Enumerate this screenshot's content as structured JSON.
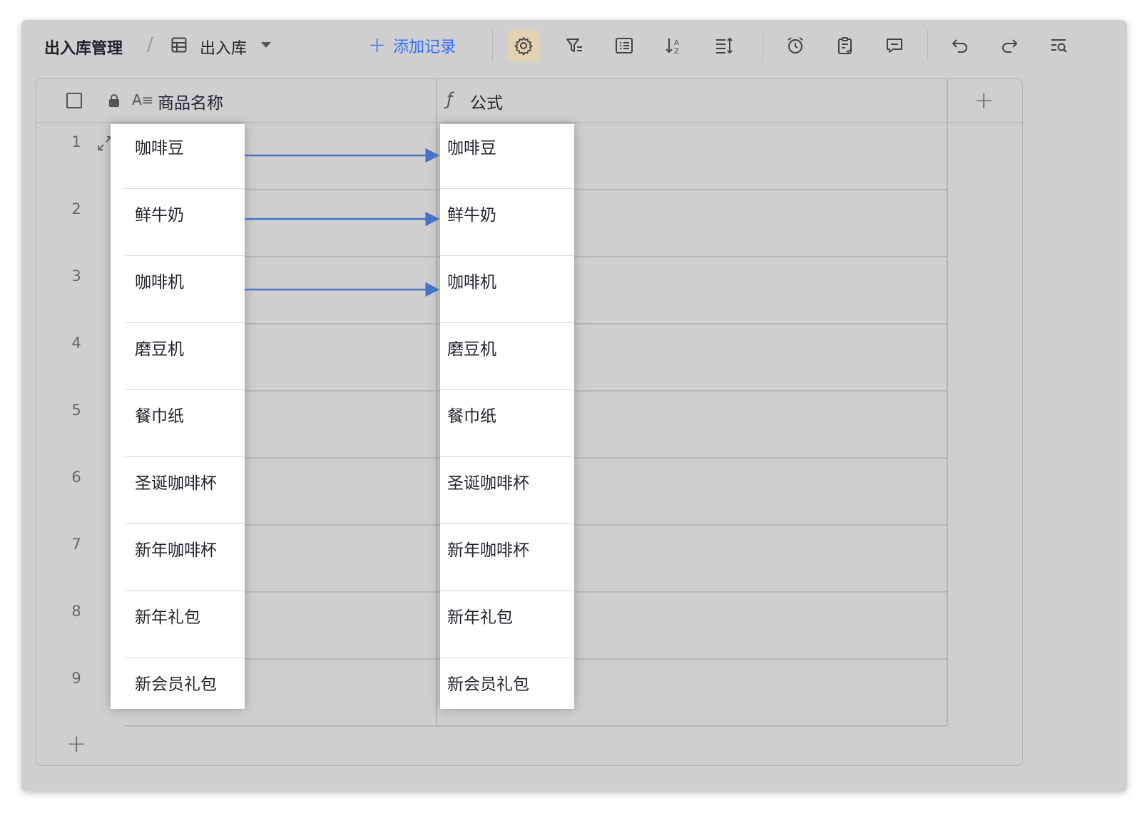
{
  "toolbar": {
    "base_name": "出入库管理",
    "separator": "/",
    "view_name": "出入库",
    "add_record_label": "添加记录",
    "plus_glyph": "+",
    "active_tool": "settings-icon",
    "tools": [
      "settings-icon",
      "filter-icon",
      "group-icon",
      "sort-icon",
      "row-height-icon",
      "reminder-icon",
      "form-icon",
      "comment-icon",
      "undo-icon",
      "redo-icon",
      "search-icon"
    ]
  },
  "table": {
    "columns": [
      {
        "name": "商品名称",
        "type": "text",
        "icon": "text-field-icon",
        "locked": true
      },
      {
        "name": "公式",
        "type": "formula",
        "icon": "formula-icon"
      }
    ],
    "text_icon_glyph": "A≡",
    "formula_icon_glyph": "ƒ",
    "add_column_glyph": "+",
    "add_row_glyph": "+",
    "rows": [
      {
        "num": "1",
        "name": "咖啡豆",
        "formula": "咖啡豆"
      },
      {
        "num": "2",
        "name": "鲜牛奶",
        "formula": "鲜牛奶"
      },
      {
        "num": "3",
        "name": "咖啡机",
        "formula": "咖啡机"
      },
      {
        "num": "4",
        "name": "磨豆机",
        "formula": "磨豆机"
      },
      {
        "num": "5",
        "name": "餐巾纸",
        "formula": "餐巾纸"
      },
      {
        "num": "6",
        "name": "圣诞咖啡杯",
        "formula": "圣诞咖啡杯"
      },
      {
        "num": "7",
        "name": "新年咖啡杯",
        "formula": "新年咖啡杯"
      },
      {
        "num": "8",
        "name": "新年礼包",
        "formula": "新年礼包"
      },
      {
        "num": "9",
        "name": "新会员礼包",
        "formula": "新会员礼包"
      }
    ]
  },
  "colors": {
    "accent": "#3370ff",
    "arrow": "#4472c4",
    "active_tool_bg": "#e2d2b2",
    "overlay_bg": "#cfcfcf"
  }
}
